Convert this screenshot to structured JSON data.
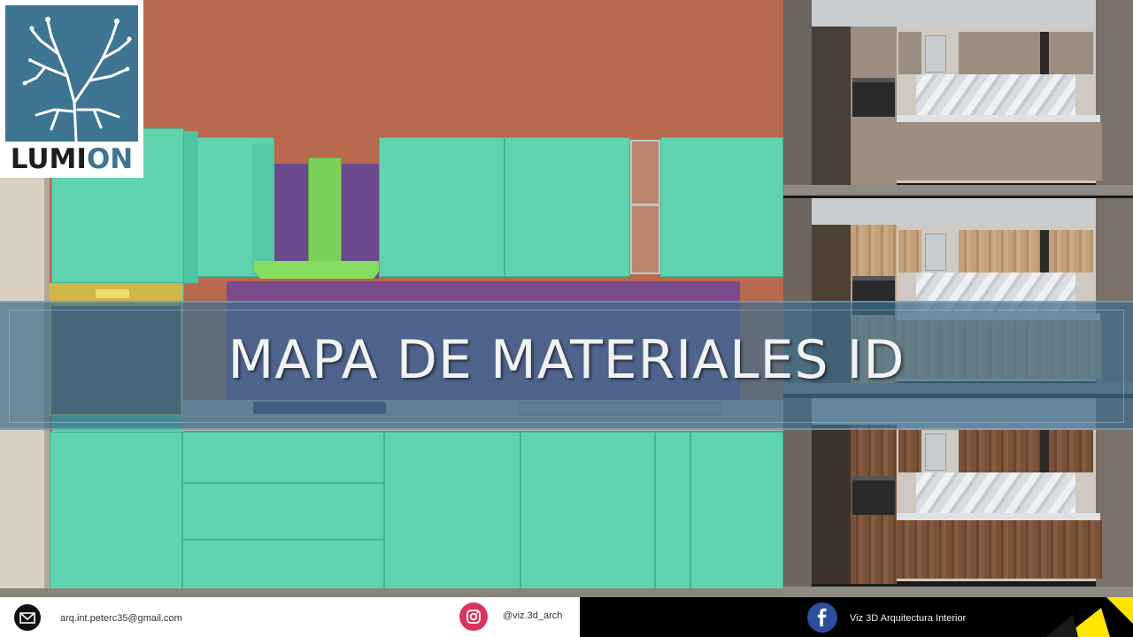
{
  "logo": {
    "brand_main": "LUMI",
    "brand_accent": "ON"
  },
  "banner": {
    "title": "MAPA DE MATERIALES ID"
  },
  "footer": {
    "email": "arq.int.peterc35@gmail.com",
    "instagram": "@viz.3d_arch",
    "facebook": "Viz 3D Arquitectura Interior"
  },
  "colors": {
    "logo_blue": "#3d7593",
    "id_teal": "#5fd3b0",
    "id_purple": "#7b4c8c",
    "id_green": "#7ad05a",
    "id_wall": "#b8694e",
    "id_oven_gold": "#d1b748",
    "banner": "#3e6e8c",
    "accent_yellow": "#ffe600"
  },
  "thumbnails": [
    "gray-finish",
    "light-oak-finish",
    "walnut-finish"
  ]
}
